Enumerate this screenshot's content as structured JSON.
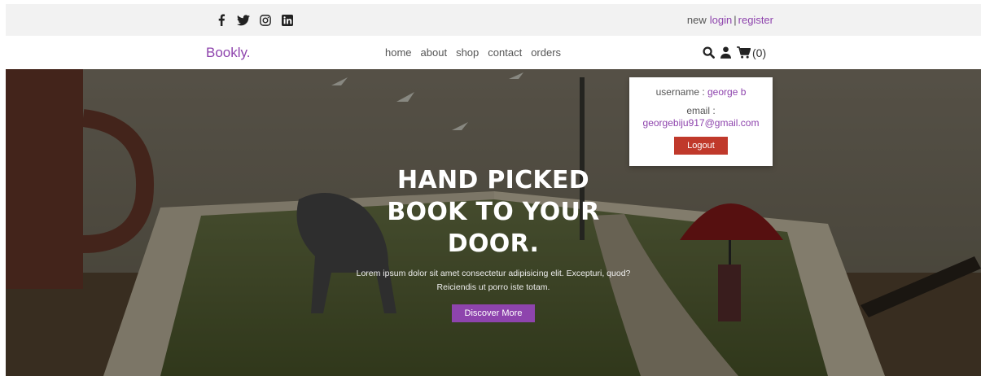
{
  "colors": {
    "accent": "#8e44ad",
    "danger": "#c0392b",
    "topbar": "#f2f2f2"
  },
  "topbar": {
    "socials": [
      "facebook-icon",
      "twitter-icon",
      "instagram-icon",
      "linkedin-icon"
    ],
    "new_text": "new",
    "login_label": "login",
    "separator": "|",
    "register_label": "register"
  },
  "nav": {
    "logo": "Bookly.",
    "menu": {
      "home": "home",
      "about": "about",
      "shop": "shop",
      "contact": "contact",
      "orders": "orders"
    },
    "icons": [
      "search-icon",
      "user-icon",
      "cart-icon"
    ],
    "cart_count": "(0)"
  },
  "hero": {
    "title": "HAND PICKED BOOK TO YOUR DOOR.",
    "text": "Lorem ipsum dolor sit amet consectetur adipisicing elit. Excepturi, quod? Reiciendis ut porro iste totam.",
    "button_label": "Discover More"
  },
  "user_box": {
    "username_label": "username :",
    "username_value": "george b",
    "email_label": "email :",
    "email_value": "georgebiju917@gmail.com",
    "logout_label": "Logout"
  }
}
